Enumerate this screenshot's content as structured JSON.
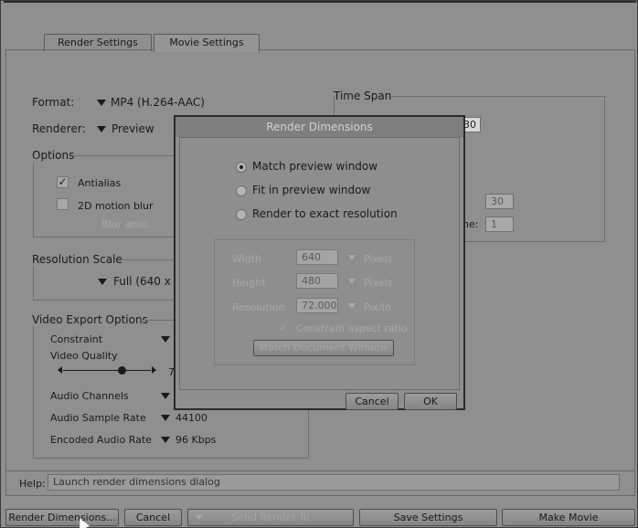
{
  "tabs": [
    {
      "label": "Render Settings",
      "active": false
    },
    {
      "label": "Movie Settings",
      "active": true
    }
  ],
  "format": {
    "label": "Format:",
    "value": "MP4 (H.264-AAC)"
  },
  "renderer": {
    "label": "Renderer:",
    "value": "Preview"
  },
  "options": {
    "title": "Options",
    "antialias": {
      "label": "Antialias",
      "checked": true
    },
    "motion_blur": {
      "label": "2D motion blur",
      "checked": false
    },
    "blur_amount": "Blur amo..."
  },
  "resolution_scale": {
    "title": "Resolution Scale",
    "value": "Full (640 x 4"
  },
  "video_export": {
    "title": "Video Export Options",
    "constraint": "Constraint",
    "video_quality": "Video Quality",
    "quality_value": "7",
    "audio_channels": "Audio Channels",
    "audio_sample_rate": "Audio Sample Rate",
    "sample_rate_value": "44100",
    "encoded_audio_rate": "Encoded Audio Rate",
    "encoded_value": "96 Kbps"
  },
  "time_span": {
    "title": "Time Span",
    "field_partial": "30",
    "fps_value": "30",
    "frame_label": "ne:",
    "frame_value": "1"
  },
  "dialog": {
    "title": "Render Dimensions",
    "options": [
      {
        "label": "Match preview window",
        "selected": true
      },
      {
        "label": "Fit in preview window",
        "selected": false
      },
      {
        "label": "Render to exact resolution",
        "selected": false
      }
    ],
    "width": {
      "label": "Width",
      "value": "640",
      "unit": "Pixels"
    },
    "height": {
      "label": "Height",
      "value": "480",
      "unit": "Pixels"
    },
    "resolution": {
      "label": "Resolution",
      "value": "72.000",
      "unit": "Pix/In"
    },
    "constrain": {
      "label": "Constrain aspect ratio",
      "checked": true
    },
    "match_doc_label": "Match Document Window",
    "cancel_label": "Cancel",
    "ok_label": "OK"
  },
  "help": {
    "label": "Help:",
    "text": "Launch render dimensions dialog"
  },
  "bottom": {
    "render_dimensions": "Render Dimensions...",
    "cancel": "Cancel",
    "send_render_to": "Send Render To",
    "save_settings": "Save Settings",
    "make_movie": "Make Movie"
  }
}
